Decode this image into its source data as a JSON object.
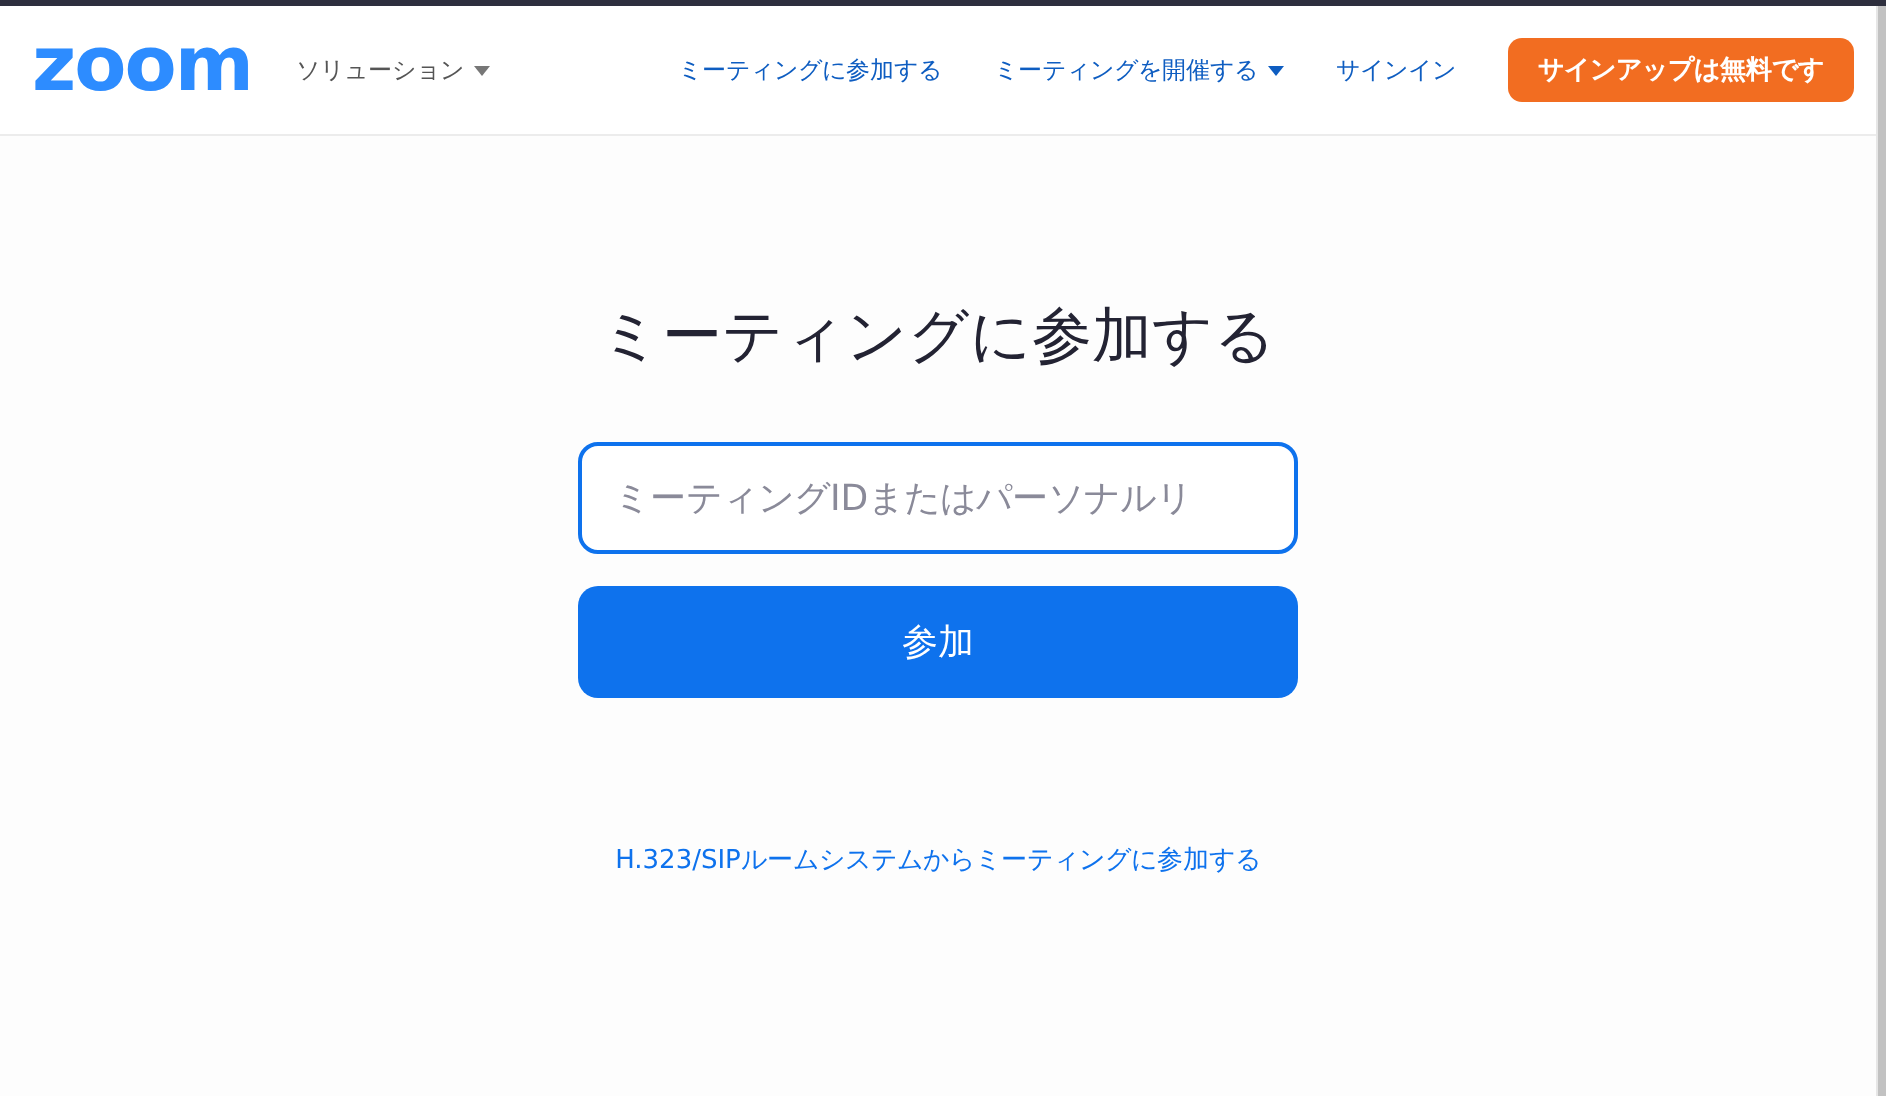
{
  "header": {
    "logo": "zoom",
    "nav": [
      {
        "label": "ソリューション",
        "kind": "menu",
        "dropdown": true
      },
      {
        "label": "ミーティングに参加する",
        "kind": "link",
        "dropdown": false
      },
      {
        "label": "ミーティングを開催する",
        "kind": "link",
        "dropdown": true
      },
      {
        "label": "サインイン",
        "kind": "link",
        "dropdown": false
      },
      {
        "label": "サインアップは無料です",
        "kind": "cta",
        "dropdown": false
      }
    ]
  },
  "main": {
    "title": "ミーティングに参加する",
    "meeting_id_field": {
      "placeholder": "ミーティングIDまたはパーソナルリ"
    },
    "join_button": "参加",
    "room_system_link": "H.323/SIPルームシステムからミーティングに参加する"
  }
}
